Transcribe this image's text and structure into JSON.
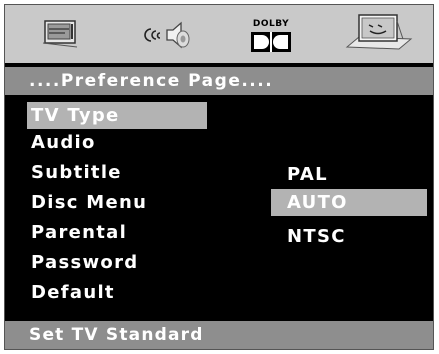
{
  "icon_bar": {
    "icons": [
      {
        "name": "general-setup-icon"
      },
      {
        "name": "audio-setup-icon"
      },
      {
        "name": "dolby-digital-icon",
        "label": "DOLBY"
      },
      {
        "name": "preference-setup-icon"
      }
    ]
  },
  "page": {
    "title": "....Preference Page...."
  },
  "menu": {
    "items": [
      {
        "label": "TV Type",
        "selected": true
      },
      {
        "label": "Audio",
        "selected": false
      },
      {
        "label": "Subtitle",
        "selected": false
      },
      {
        "label": "Disc Menu",
        "selected": false
      },
      {
        "label": "Parental",
        "selected": false
      },
      {
        "label": "Password",
        "selected": false
      },
      {
        "label": "Default",
        "selected": false
      }
    ]
  },
  "options": {
    "items": [
      {
        "label": "PAL",
        "selected": false
      },
      {
        "label": "AUTO",
        "selected": true
      },
      {
        "label": "NTSC",
        "selected": false
      }
    ]
  },
  "status": {
    "text": "Set TV Standard"
  },
  "colors": {
    "background": "#000000",
    "bar": "#8e8e8e",
    "icon_bar": "#c9c9c9",
    "highlight": "#b3b3b3",
    "text": "#ffffff"
  }
}
